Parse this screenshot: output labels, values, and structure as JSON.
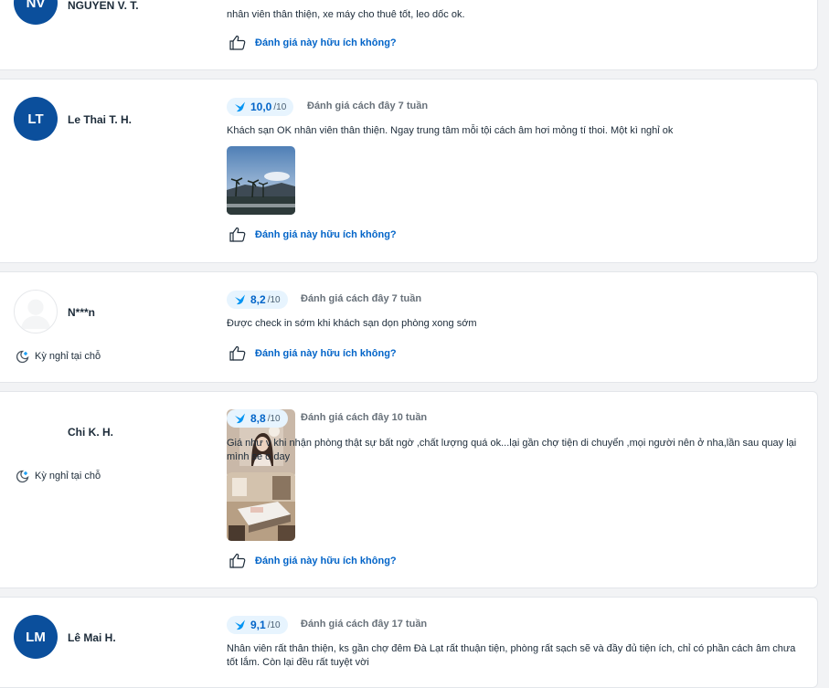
{
  "reviews": [
    {
      "initials": "NV",
      "name": "NGUYEN V. T.",
      "text": "nhân viên thân thiện, xe máy cho thuê tốt, leo dốc ok.",
      "helpful": "Đánh giá này hữu ích không?"
    },
    {
      "initials": "LT",
      "name": "Le Thai T. H.",
      "score": "10,0",
      "scale": "/10",
      "when": "Đánh giá cách đây 7 tuần",
      "text": "Khách sạn OK nhân viên thân thiện. Ngay trung tâm mỗi tội cách âm hơi mỏng tí thoi. Một kì nghỉ ok",
      "helpful": "Đánh giá này hữu ích không?"
    },
    {
      "name": "N***n",
      "stay": "Kỳ nghỉ tại chỗ",
      "score": "8,2",
      "scale": "/10",
      "when": "Đánh giá cách đây 7 tuần",
      "text": "Được check in sớm khi khách sạn dọn phòng xong sớm",
      "helpful": "Đánh giá này hữu ích không?"
    },
    {
      "name": "Chi K. H.",
      "stay": "Kỳ nghỉ tại chỗ",
      "score": "8,8",
      "scale": "/10",
      "when": "Đánh giá cách đây 10 tuần",
      "text": "Giá như v khi nhận phòng thật sự bất ngờ ,chất lượng quá ok...lại gần chợ tiện di chuyển ,mọi người nên ở nha,lần sau quay lại mình se o day",
      "helpful": "Đánh giá này hữu ích không?"
    },
    {
      "initials": "LM",
      "name": "Lê Mai H.",
      "score": "9,1",
      "scale": "/10",
      "when": "Đánh giá cách đây 17 tuần",
      "text": "Nhân viên rất thân thiện, ks gần chợ đêm Đà Lạt rất thuận tiện, phòng rất sạch sẽ và đầy đủ tiện ích, chỉ có phần cách âm chưa tốt lắm. Còn lại đều rất tuyệt vời"
    }
  ],
  "icons": {
    "rating": "traveloka-bird-icon",
    "helpful": "thumbs-up-icon",
    "stay": "moon-plus-icon"
  },
  "colors": {
    "accent": "#0264c8",
    "avatar": "#0b4f9c",
    "rating_bg": "#e7f4fe",
    "active_tab": "#0194f3"
  }
}
